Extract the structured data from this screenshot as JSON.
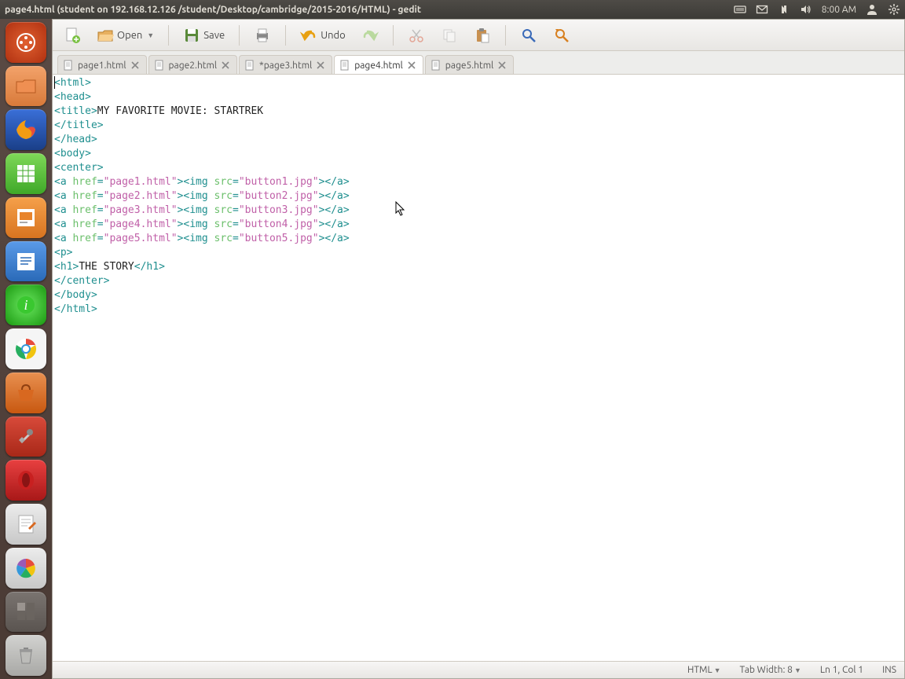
{
  "topbar": {
    "title": "page4.html (student on 192.168.12.126 /student/Desktop/cambridge/2015-2016/HTML) - gedit",
    "time": "8:00 AM"
  },
  "toolbar": {
    "open": "Open",
    "save": "Save",
    "undo": "Undo"
  },
  "tabs": [
    {
      "label": "page1.html",
      "active": false
    },
    {
      "label": "page2.html",
      "active": false
    },
    {
      "label": "*page3.html",
      "active": false
    },
    {
      "label": "page4.html",
      "active": true
    },
    {
      "label": "page5.html",
      "active": false
    }
  ],
  "code": {
    "title_text": "MY FAVORITE MOVIE: STARTREK",
    "links": [
      {
        "href": "page1.html",
        "src": "button1.jpg"
      },
      {
        "href": "page2.html",
        "src": "button2.jpg"
      },
      {
        "href": "page3.html",
        "src": "button3.jpg"
      },
      {
        "href": "page4.html",
        "src": "button4.jpg"
      },
      {
        "href": "page5.html",
        "src": "button5.jpg"
      }
    ],
    "h1_text": "THE STORY"
  },
  "statusbar": {
    "lang": "HTML",
    "tabwidth": "Tab Width: 8",
    "pos": "Ln 1, Col 1",
    "ins": "INS"
  }
}
